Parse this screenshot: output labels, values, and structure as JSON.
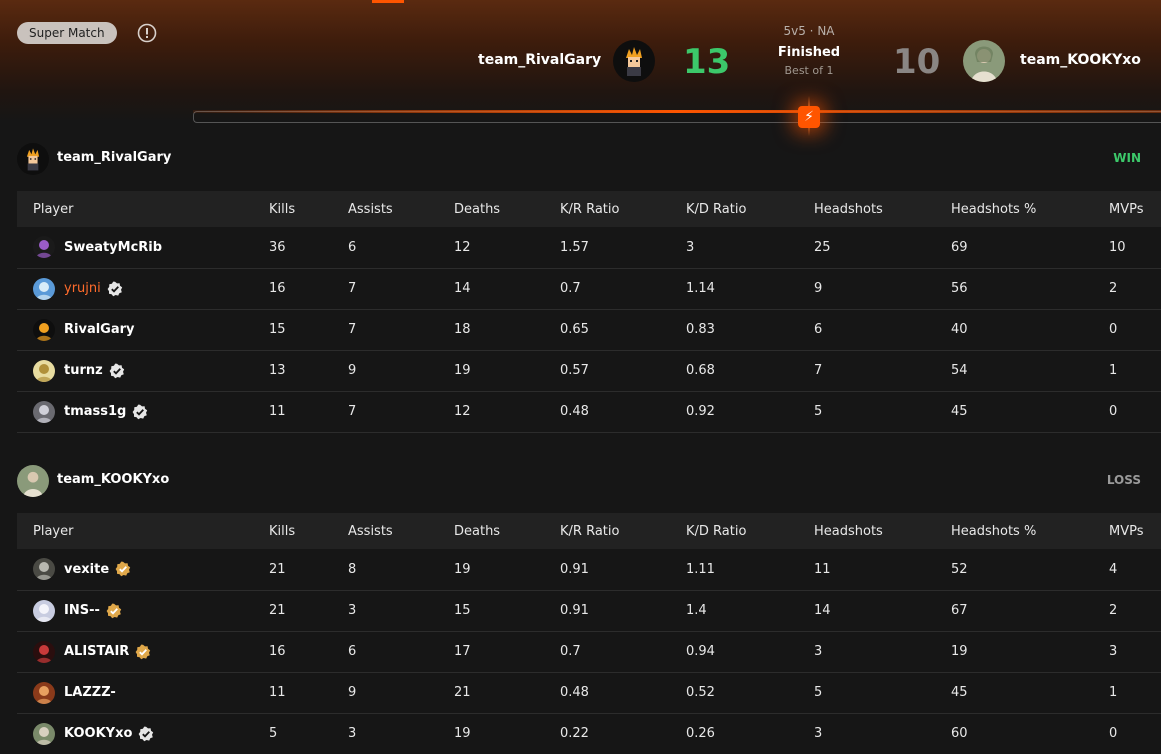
{
  "header": {
    "badge_label": "Super Match",
    "mode": "5v5 · NA",
    "status": "Finished",
    "best_of": "Best of 1",
    "team1": {
      "name": "team_RivalGary",
      "score": "13"
    },
    "team2": {
      "name": "team_KOOKYxo",
      "score": "10"
    }
  },
  "columns": [
    "Player",
    "Kills",
    "Assists",
    "Deaths",
    "K/R Ratio",
    "K/D Ratio",
    "Headshots",
    "Headshots %",
    "MVPs"
  ],
  "teams": [
    {
      "name": "team_RivalGary",
      "result": "WIN",
      "players": [
        {
          "name": "SweatyMcRib",
          "badge": "none",
          "stats": [
            "36",
            "6",
            "12",
            "1.57",
            "3",
            "25",
            "69",
            "10"
          ]
        },
        {
          "name": "yrujni",
          "badge": "verified",
          "stats": [
            "16",
            "7",
            "14",
            "0.7",
            "1.14",
            "9",
            "56",
            "2"
          ]
        },
        {
          "name": "RivalGary",
          "badge": "none",
          "stats": [
            "15",
            "7",
            "18",
            "0.65",
            "0.83",
            "6",
            "40",
            "0"
          ]
        },
        {
          "name": "turnz",
          "badge": "verified",
          "stats": [
            "13",
            "9",
            "19",
            "0.57",
            "0.68",
            "7",
            "54",
            "1"
          ]
        },
        {
          "name": "tmass1g",
          "badge": "verified",
          "stats": [
            "11",
            "7",
            "12",
            "0.48",
            "0.92",
            "5",
            "45",
            "0"
          ]
        }
      ]
    },
    {
      "name": "team_KOOKYxo",
      "result": "LOSS",
      "players": [
        {
          "name": "vexite",
          "badge": "gold",
          "stats": [
            "21",
            "8",
            "19",
            "0.91",
            "1.11",
            "11",
            "52",
            "4"
          ]
        },
        {
          "name": "INS--",
          "badge": "gold",
          "stats": [
            "21",
            "3",
            "15",
            "0.91",
            "1.4",
            "14",
            "67",
            "2"
          ]
        },
        {
          "name": "ALISTAIR",
          "badge": "gold",
          "stats": [
            "16",
            "6",
            "17",
            "0.7",
            "0.94",
            "3",
            "19",
            "3"
          ]
        },
        {
          "name": "LAZZZ-",
          "badge": "none",
          "stats": [
            "11",
            "9",
            "21",
            "0.48",
            "0.52",
            "5",
            "45",
            "1"
          ]
        },
        {
          "name": "KOOKYxo",
          "badge": "verified",
          "stats": [
            "5",
            "3",
            "19",
            "0.22",
            "0.26",
            "3",
            "60",
            "0"
          ]
        }
      ]
    }
  ],
  "colors": {
    "accent": "#ff5500",
    "win": "#3cc86a",
    "loss": "#9a9a9a",
    "highlight_player": "#ff6b2b"
  }
}
